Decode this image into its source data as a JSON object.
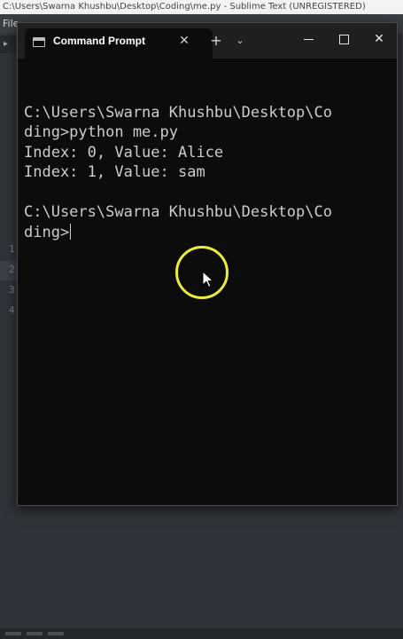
{
  "sublime": {
    "title": "C:\\Users\\Swarna Khushbu\\Desktop\\Coding\\me.py - Sublime Text (UNREGISTERED)",
    "menu_first": "File",
    "gutter_numbers": [
      "1",
      "2",
      "3",
      "4"
    ]
  },
  "terminal": {
    "tab_title": "Command Prompt",
    "tab_close": "✕",
    "new_tab": "+",
    "dropdown": "⌄",
    "close_button": "✕",
    "lines": [
      "C:\\Users\\Swarna Khushbu\\Desktop\\Co",
      "ding>python me.py",
      "Index: 0, Value: Alice",
      "Index: 1, Value: sam",
      "",
      "C:\\Users\\Swarna Khushbu\\Desktop\\Co",
      "ding>"
    ]
  },
  "colors": {
    "terminal_background": "#0c0c0c",
    "terminal_text": "#cccccc",
    "cursor_highlight": "#ecec3a"
  }
}
